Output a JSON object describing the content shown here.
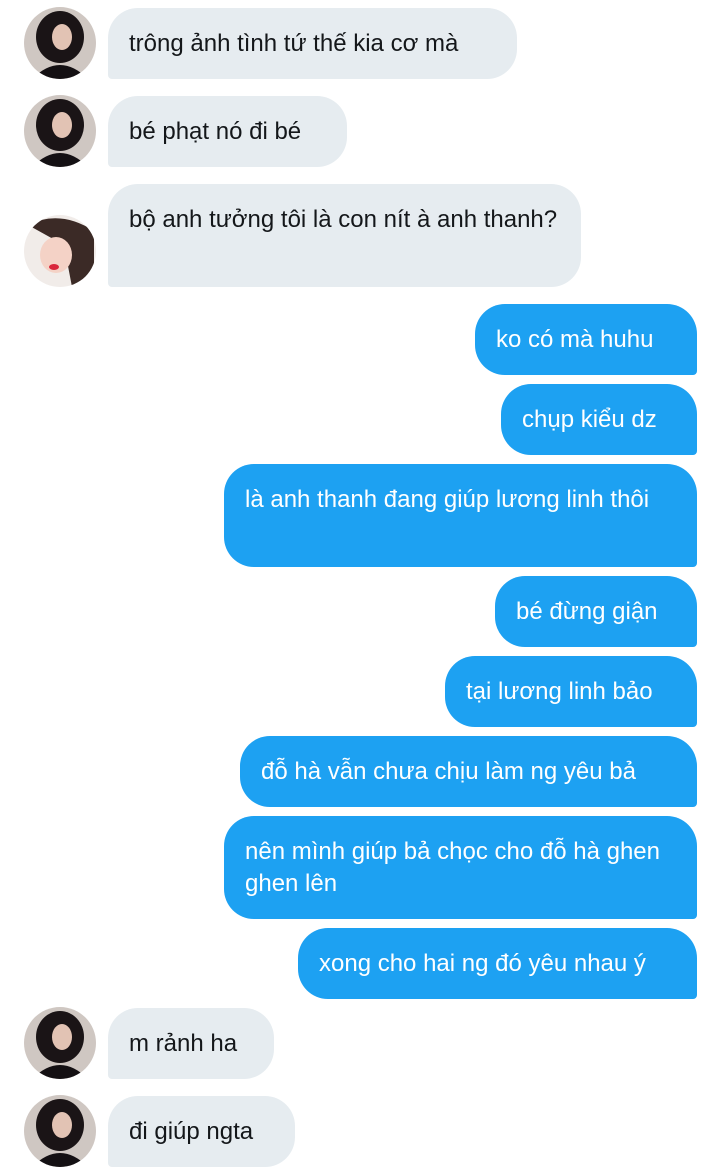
{
  "conversation": {
    "messages": [
      {
        "sender": "other",
        "text": "trông ảnh tình tứ thế kia cơ mà",
        "avatar": "dark-hair-avatar"
      },
      {
        "sender": "other",
        "text": "bé phạt nó đi bé",
        "avatar": "dark-hair-avatar"
      },
      {
        "sender": "other",
        "text": "bộ anh tưởng tôi là con nít à anh thanh?",
        "avatar": "selfie-avatar"
      },
      {
        "sender": "me",
        "text": "ko có mà huhu"
      },
      {
        "sender": "me",
        "text": "chụp kiểu dz"
      },
      {
        "sender": "me",
        "text": "là anh thanh đang giúp lương linh thôi"
      },
      {
        "sender": "me",
        "text": "bé đừng giận"
      },
      {
        "sender": "me",
        "text": "tại lương linh bảo"
      },
      {
        "sender": "me",
        "text": "đỗ hà vẫn chưa chịu làm ng yêu bả"
      },
      {
        "sender": "me",
        "text": "nên mình giúp bả chọc cho đỗ hà ghen ghen lên"
      },
      {
        "sender": "me",
        "text": "xong cho hai ng đó yêu nhau ý"
      },
      {
        "sender": "other",
        "text": "m rảnh ha",
        "avatar": "dark-hair-avatar"
      },
      {
        "sender": "other",
        "text": "đi giúp ngta",
        "avatar": "dark-hair-avatar"
      }
    ]
  },
  "colors": {
    "incoming_bubble": "#e6ecf0",
    "outgoing_bubble": "#1da1f2",
    "incoming_text": "#14171a",
    "outgoing_text": "#ffffff"
  }
}
